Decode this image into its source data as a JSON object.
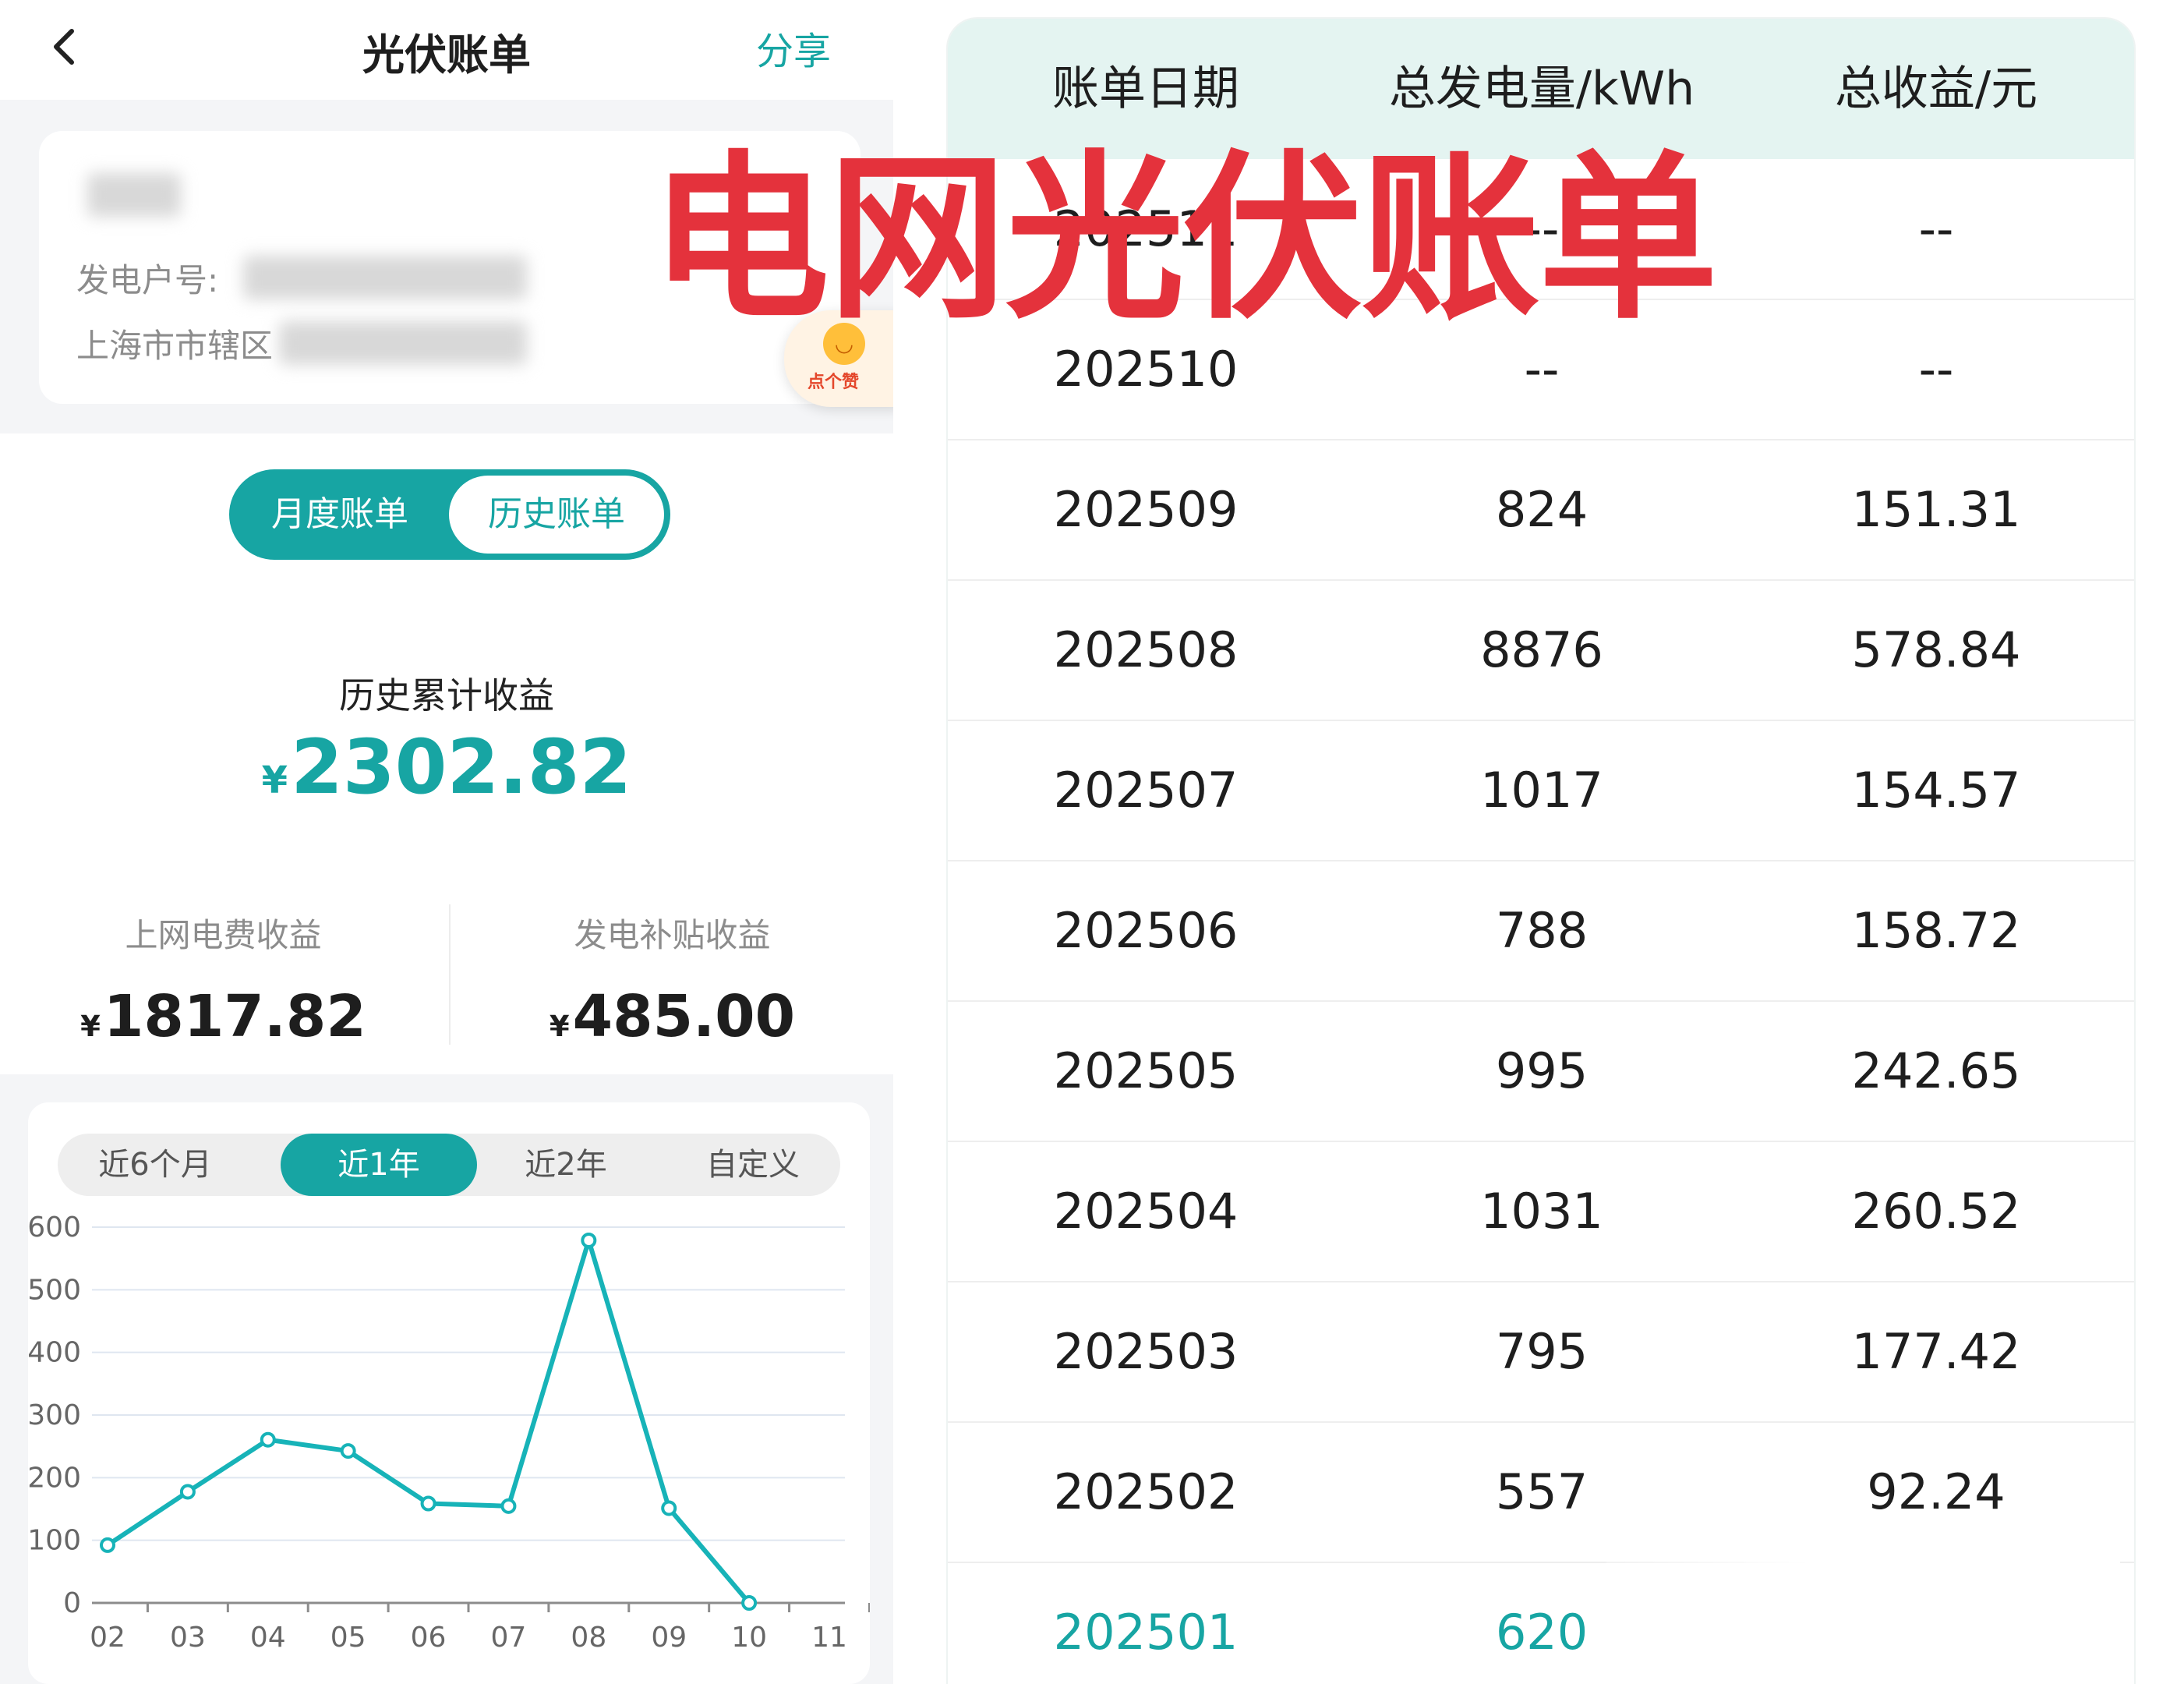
{
  "overlay": {
    "caption": "电网光伏账单"
  },
  "nav": {
    "title": "光伏账单",
    "share_label": "分享"
  },
  "account": {
    "household_label": "发电户号:",
    "region_label": "上海市市辖区"
  },
  "reaction": {
    "label": "点个赞"
  },
  "tabs": {
    "monthly": "月度账单",
    "history": "历史账单",
    "active": "history"
  },
  "summary": {
    "total_label": "历史累计收益",
    "currency": "¥",
    "total_value": "2302.82",
    "grid_label": "上网电费收益",
    "grid_value": "1817.82",
    "subsidy_label": "发电补贴收益",
    "subsidy_value": "485.00"
  },
  "ranges": {
    "items": [
      "近6个月",
      "近1年",
      "近2年",
      "自定义"
    ],
    "active_index": 1
  },
  "chart_data": {
    "type": "line",
    "categories": [
      "02",
      "03",
      "04",
      "05",
      "06",
      "07",
      "08",
      "09",
      "10",
      "11"
    ],
    "values": [
      92.24,
      177.42,
      260.52,
      242.65,
      158.72,
      154.57,
      578.84,
      151.31,
      0,
      null
    ],
    "yticks": [
      0,
      100,
      200,
      300,
      400,
      500,
      600
    ],
    "ylim": [
      0,
      600
    ],
    "grid": true,
    "line_color": "#17b3b8",
    "title": "",
    "xlabel": "",
    "ylabel": ""
  },
  "table": {
    "headers": [
      "账单日期",
      "总发电量/kWh",
      "总收益/元"
    ],
    "rows": [
      [
        "202511",
        "--",
        "--"
      ],
      [
        "202510",
        "--",
        "--"
      ],
      [
        "202509",
        "824",
        "151.31"
      ],
      [
        "202508",
        "8876",
        "578.84"
      ],
      [
        "202507",
        "1017",
        "154.57"
      ],
      [
        "202506",
        "788",
        "158.72"
      ],
      [
        "202505",
        "995",
        "242.65"
      ],
      [
        "202504",
        "1031",
        "260.52"
      ],
      [
        "202503",
        "795",
        "177.42"
      ],
      [
        "202502",
        "557",
        "92.24"
      ],
      [
        "202501",
        "620",
        ""
      ]
    ],
    "highlight_row_index": 10
  },
  "colors": {
    "accent": "#17a5a3",
    "overlay_red": "#e4323c",
    "header_bg": "#e4f4f1"
  }
}
